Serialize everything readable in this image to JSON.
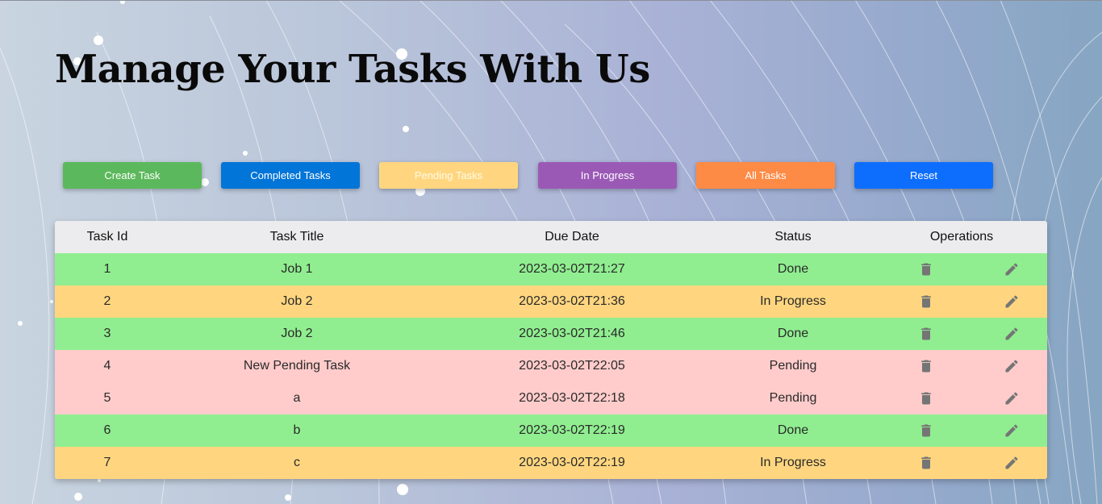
{
  "page": {
    "title": "Manage Your Tasks With Us"
  },
  "buttons": {
    "create": "Create Task",
    "completed": "Completed Tasks",
    "pending": "Pending Tasks",
    "in_progress": "In Progress",
    "all": "All Tasks",
    "reset": "Reset"
  },
  "colors": {
    "create": "#5cb85c",
    "completed": "#0275d8",
    "pending": "#ffd67f",
    "in_progress": "#9b59b6",
    "all": "#fd8a45",
    "reset": "#0d6efd",
    "row_done": "#90ee90",
    "row_in_progress": "#ffd67f",
    "row_pending": "#ffcccb"
  },
  "table": {
    "headers": {
      "id": "Task Id",
      "title": "Task Title",
      "due": "Due Date",
      "status": "Status",
      "ops": "Operations"
    },
    "rows": [
      {
        "id": "1",
        "title": "Job 1",
        "due": "2023-03-02T21:27",
        "status": "Done"
      },
      {
        "id": "2",
        "title": "Job 2",
        "due": "2023-03-02T21:36",
        "status": "In Progress"
      },
      {
        "id": "3",
        "title": "Job 2",
        "due": "2023-03-02T21:46",
        "status": "Done"
      },
      {
        "id": "4",
        "title": "New Pending Task",
        "due": "2023-03-02T22:05",
        "status": "Pending"
      },
      {
        "id": "5",
        "title": "a",
        "due": "2023-03-02T22:18",
        "status": "Pending"
      },
      {
        "id": "6",
        "title": "b",
        "due": "2023-03-02T22:19",
        "status": "Done"
      },
      {
        "id": "7",
        "title": "c",
        "due": "2023-03-02T22:19",
        "status": "In Progress"
      }
    ],
    "icons": {
      "delete": "trash-icon",
      "edit": "pencil-icon"
    }
  }
}
